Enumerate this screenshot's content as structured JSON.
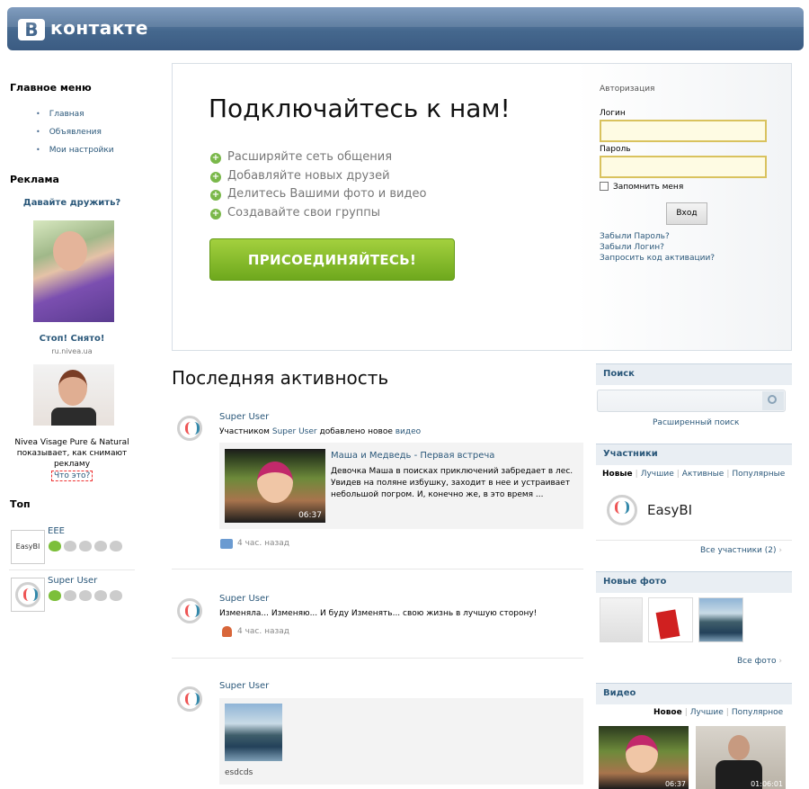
{
  "header": {
    "logo_letter": "В",
    "logo_text": "контакте"
  },
  "left": {
    "main_menu_title": "Главное меню",
    "menu": [
      "Главная",
      "Объявления",
      "Мои настройки"
    ],
    "ads_title": "Реклама",
    "ad1": {
      "title": "Давайте дружить?",
      "caption": "Стоп! Снято!",
      "domain": "ru.nivea.ua"
    },
    "ad2": {
      "text": "Nivea Visage Pure & Natural показывает, как снимают рекламу",
      "link": "Что это?"
    },
    "top_title": "Топ",
    "top_items": [
      {
        "name": "EEE",
        "avatar_label": "EasyBI"
      },
      {
        "name": "Super User",
        "avatar_label": ""
      }
    ]
  },
  "panel": {
    "title": "Подключайтесь к нам!",
    "features": [
      "Расширяйте сеть общения",
      "Добавляйте новых друзей",
      "Делитесь Вашими фото и видео",
      "Создавайте свои группы"
    ],
    "join_button": "ПРИСОЕДИНЯЙТЕСЬ!",
    "auth": {
      "title": "Авторизация",
      "login_label": "Логин",
      "password_label": "Пароль",
      "remember": "Запомнить меня",
      "submit": "Вход",
      "forgot_password": "Забыли Пароль?",
      "forgot_login": "Забыли Логин?",
      "request_code": "Запросить код активации?"
    }
  },
  "activity": {
    "title": "Последняя активность",
    "items": [
      {
        "user": "Super User",
        "action_prefix": "Участником",
        "action_user": "Super User",
        "action_middle": "добавлено новое",
        "action_link": "видео",
        "video_title": "Маша и Медведь - Первая встреча",
        "video_desc": "Девочка Маша в поисках приключений забредает в лес. Увидев на поляне избушку, заходит в нее и устраивает небольшой погром. И, конечно же, в это время ...",
        "duration": "06:37",
        "time": "4 час. назад"
      },
      {
        "user": "Super User",
        "text": "Изменяла... Изменяю... И буду Изменять... свою жизнь в лучшую сторону!",
        "time": "4 час. назад"
      },
      {
        "user": "Super User",
        "photo_caption": "esdcds"
      }
    ]
  },
  "right": {
    "search_title": "Поиск",
    "search_placeholder": "",
    "advanced_search": "Расширенный поиск",
    "members_title": "Участники",
    "member_tabs": [
      "Новые",
      "Лучшие",
      "Активные",
      "Популярные"
    ],
    "member_name": "EasyBI",
    "all_members": "Все участники (2)",
    "photos_title": "Новые фото",
    "all_photos": "Все фото",
    "video_title": "Видео",
    "video_tabs": [
      "Новое",
      "Лучшие",
      "Популярное"
    ],
    "video_durations": [
      "06:37",
      "01:06:01"
    ]
  },
  "colors": {
    "brand": "#45688e",
    "link": "#2b587a",
    "join_green": "#7ab84a"
  }
}
